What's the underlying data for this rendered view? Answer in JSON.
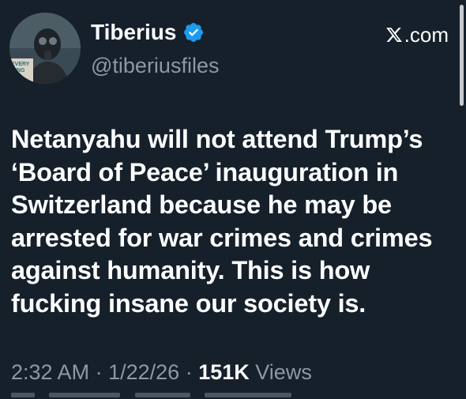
{
  "author": {
    "display_name": "Tiberius",
    "handle": "@tiberiusfiles",
    "verified_icon": "verified-badge-icon",
    "avatar_sign_text": "EVERY HING ED"
  },
  "source": {
    "site_label": ".com",
    "logo_icon": "x-logo-icon"
  },
  "tweet": {
    "text": "Netanyahu will not attend Trump’s\n‘Board of Peace’ inauguration in\nSwitzerland because he may be\narrested for war crimes and crimes\nagainst humanity. This is how\nfucking insane our society is."
  },
  "meta": {
    "time": "2:32 AM",
    "separator": "·",
    "date": "1/22/26",
    "views_count": "151K",
    "views_label": "Views"
  },
  "colors": {
    "background": "#15202b",
    "text_primary": "#ffffff",
    "text_secondary": "#8b98a5",
    "verified_blue": "#1d9bf0"
  }
}
